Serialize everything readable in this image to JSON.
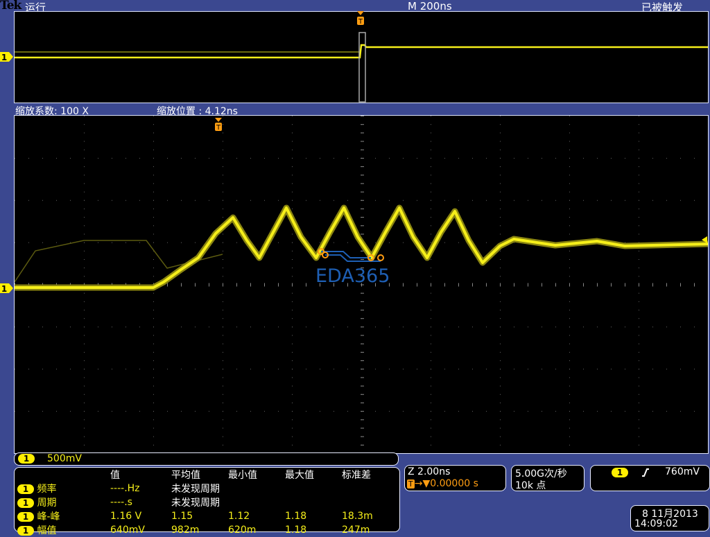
{
  "header": {
    "brand": "Tek",
    "run_state": "运行",
    "timebase": "M 200ns",
    "trigger_state": "已被触发"
  },
  "zoom_bar": {
    "factor_label": "缩放系数: 100 X",
    "position_label": "缩放位置 :  4.12ns"
  },
  "channel": {
    "number": "1",
    "scale": "500mV",
    "color": "#f6ef1a"
  },
  "watermark": "EDA365",
  "measurements": {
    "headers": [
      "值",
      "平均值",
      "最小值",
      "最大值",
      "标准差"
    ],
    "rows": [
      {
        "ch": "1",
        "name": "频率",
        "value": "----.Hz",
        "note": "未发现周期"
      },
      {
        "ch": "1",
        "name": "周期",
        "value": "----.s",
        "note": "未发现周期"
      },
      {
        "ch": "1",
        "name": "峰-峰",
        "value": "1.16 V",
        "mean": "1.15",
        "min": "1.12",
        "max": "1.18",
        "std": "18.3m"
      },
      {
        "ch": "1",
        "name": "幅值",
        "value": "640mV",
        "mean": "982m",
        "min": "620m",
        "max": "1.18",
        "std": "247m"
      }
    ]
  },
  "zoom_info": {
    "scale": "Z 2.00ns",
    "trigger_pos": "0.00000 s"
  },
  "acq": {
    "rate": "5.00G次/秒",
    "points": "10k 点"
  },
  "trigger": {
    "channel": "1",
    "slope": "rising",
    "level": "760mV"
  },
  "datetime": {
    "date": "8 11月2013",
    "time": "14:09:02"
  }
}
